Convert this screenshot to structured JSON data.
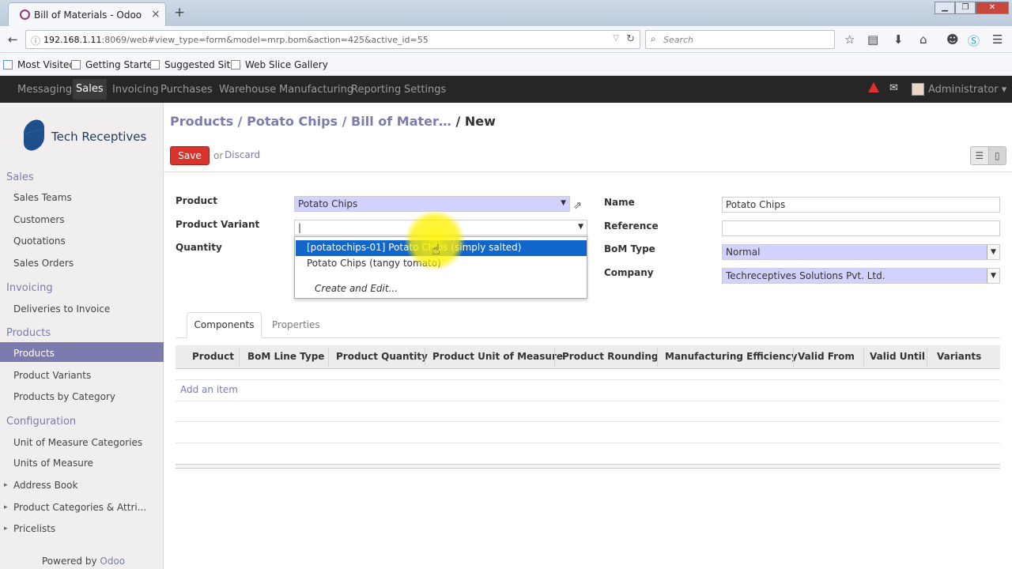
{
  "browser": {
    "tab_title": "Bill of Materials - Odoo",
    "tab_close": "×",
    "new_tab": "+",
    "url_host": "192.168.1.11",
    "url_rest": ":8069/web#view_type=form&model=mrp.bom&action=425&active_id=55",
    "search_placeholder": "Search",
    "bookmarks": [
      "Most Visited",
      "Getting Started",
      "Suggested Sites",
      "Web Slice Gallery"
    ]
  },
  "topbar": {
    "menus": [
      "Messaging",
      "Sales",
      "Invoicing",
      "Purchases",
      "Warehouse",
      "Manufacturing",
      "Reporting",
      "Settings"
    ],
    "active_menu": "Sales",
    "user": "Administrator ▾"
  },
  "sidebar": {
    "company": "Tech Receptives",
    "sections": [
      {
        "title": "Sales",
        "items": [
          "Sales Teams",
          "Customers",
          "Quotations",
          "Sales Orders"
        ]
      },
      {
        "title": "Invoicing",
        "items": [
          "Deliveries to Invoice"
        ]
      },
      {
        "title": "Products",
        "items": [
          "Products",
          "Product Variants",
          "Products by Category"
        ]
      },
      {
        "title": "Configuration",
        "items": [
          "Unit of Measure Categories",
          "Units of Measure",
          "Address Book",
          "Product Categories & Attri...",
          "Pricelists"
        ]
      }
    ],
    "selected_item": "Products",
    "powered_prefix": "Powered by ",
    "powered_brand": "Odoo"
  },
  "main": {
    "breadcrumb": "Products / Potato Chips / Bill of Mater…",
    "breadcrumb_current": " / New",
    "save_label": "Save",
    "or_label": "or",
    "discard_label": "Discard",
    "view_list_icon": "☰",
    "view_form_icon": "▯"
  },
  "form": {
    "product_label": "Product",
    "product_value": "Potato Chips",
    "variant_label": "Product Variant",
    "variant_value": "|",
    "quantity_label": "Quantity",
    "name_label": "Name",
    "name_value": "Potato Chips",
    "reference_label": "Reference",
    "reference_value": "",
    "bom_type_label": "BoM Type",
    "bom_type_value": "Normal",
    "company_label": "Company",
    "company_value": "Techreceptives Solutions Pvt. Ltd."
  },
  "dropdown": {
    "options": [
      "[potatochips-01] Potato Chips (simply salted)",
      "Potato Chips (tangy tomato)"
    ],
    "create_edit": "Create and Edit..."
  },
  "tabs": [
    "Components",
    "Properties"
  ],
  "table": {
    "columns": [
      "Product",
      "BoM Line Type",
      "Product Quantity",
      "Product Unit of Measure",
      "Product Rounding",
      "Manufacturing Efficiency",
      "Valid From",
      "Valid Until",
      "Variants"
    ],
    "add_item": "Add an item"
  }
}
